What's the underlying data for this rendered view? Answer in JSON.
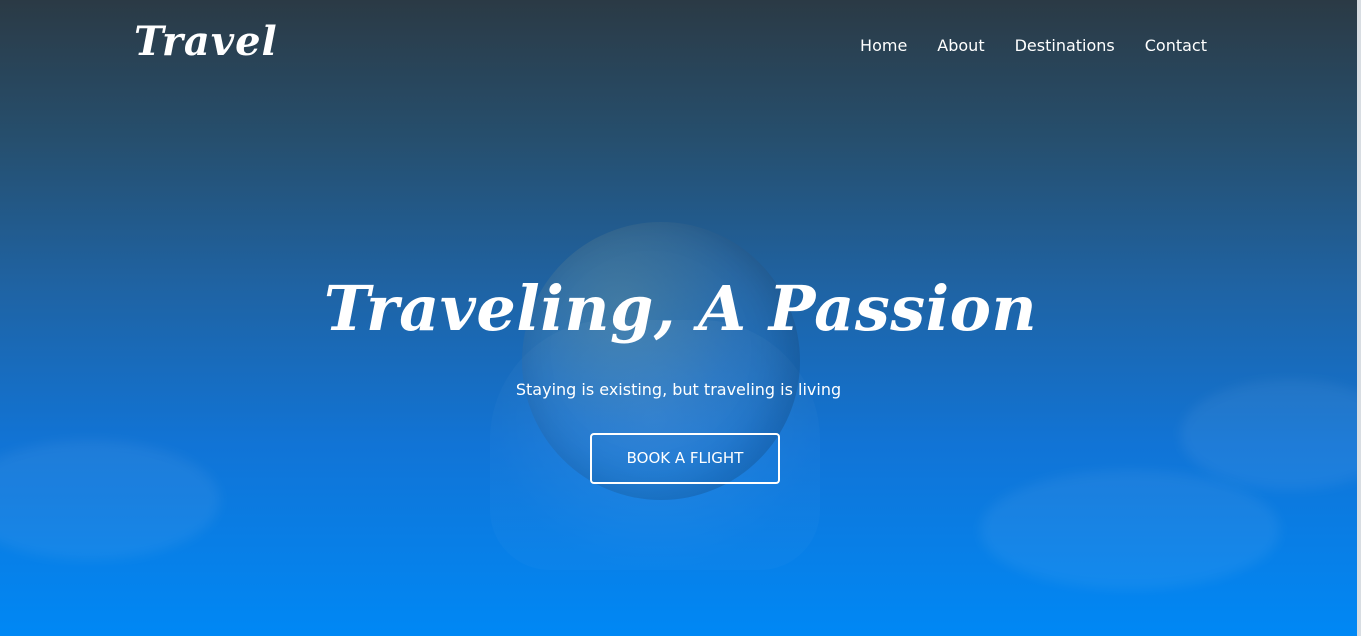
{
  "brand": {
    "logo_text": "Travel"
  },
  "nav": {
    "items": [
      {
        "label": "Home"
      },
      {
        "label": "About"
      },
      {
        "label": "Destinations"
      },
      {
        "label": "Contact"
      }
    ]
  },
  "hero": {
    "title": "Traveling, A Passion",
    "subtitle": "Staying is existing, but traveling is living",
    "cta_label": "BOOK A FLIGHT"
  },
  "colors": {
    "text": "#ffffff",
    "background_top": "#2b3a45",
    "background_bottom": "#0088f5"
  }
}
